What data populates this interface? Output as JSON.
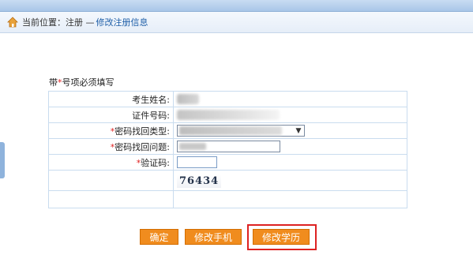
{
  "breadcrumb": {
    "prefix": "当前位置：注册 —",
    "current": "修改注册信息"
  },
  "required_note": {
    "before": "带",
    "star": "*",
    "after": "号项必须填写"
  },
  "form": {
    "name_label": "考生姓名:",
    "id_label": "证件号码:",
    "recovery_type_star": "*",
    "recovery_type_label": "密码找回类型:",
    "recovery_question_star": "*",
    "recovery_question_label": "密码找回问题:",
    "captcha_star": "*",
    "captcha_label": "验证码:",
    "captcha_code": "76434"
  },
  "buttons": {
    "confirm": "确定",
    "edit_phone": "修改手机",
    "edit_education": "修改学历"
  },
  "icons": {
    "home": "home-icon",
    "dropdown": "chevron-down-icon"
  },
  "colors": {
    "button_orange": "#f08c1e",
    "required_red": "#e02020",
    "link_blue": "#1f5fa8",
    "highlight_red": "#dd2222"
  }
}
